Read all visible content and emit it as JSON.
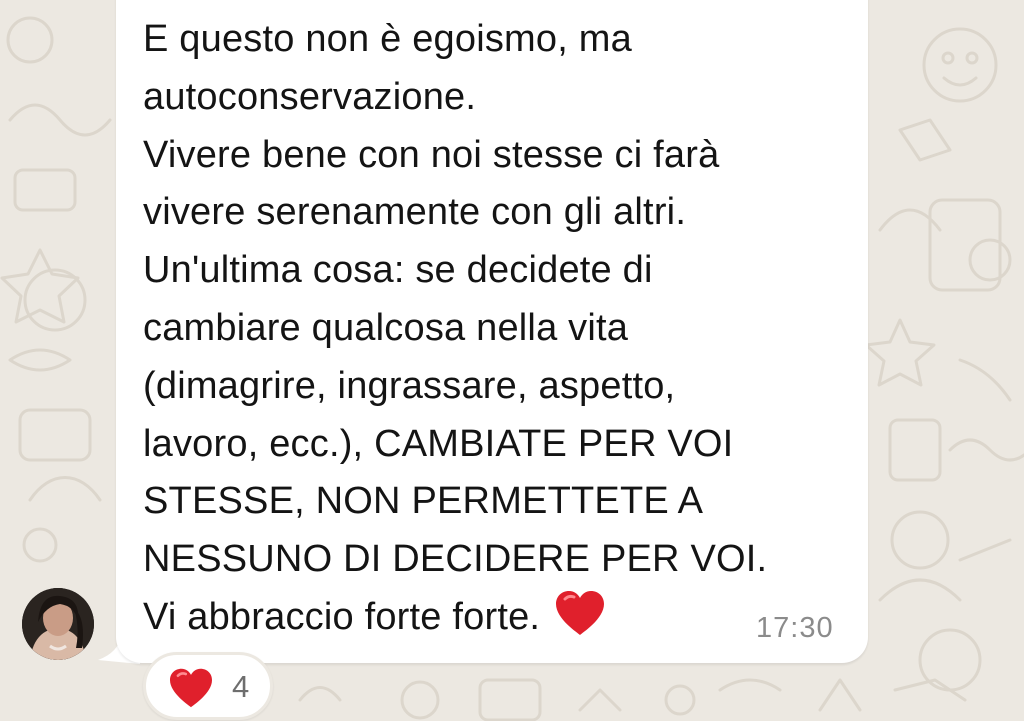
{
  "message": {
    "lines": [
      "E questo non è egoismo, ma",
      "autoconservazione.",
      "Vivere bene con noi stesse ci farà",
      "vivere serenamente con gli altri.",
      "Un'ultima cosa: se decidete di",
      "cambiare qualcosa nella vita",
      "(dimagrire, ingrassare, aspetto,",
      "lavoro, ecc.), CAMBIATE PER VOI",
      "STESSE, NON PERMETTETE A",
      "NESSUNO DI DECIDERE PER VOI.",
      "Vi abbraccio forte forte."
    ],
    "emoji_icon": "red-heart-icon",
    "timestamp": "17:30"
  },
  "reaction": {
    "emoji_icon": "red-heart-icon",
    "count": "4"
  },
  "sender": {
    "avatar_icon": "profile-photo"
  },
  "colors": {
    "background": "#ece8e1",
    "bubble": "#ffffff",
    "text": "#141414",
    "timestamp": "#8b8b8b",
    "heart": "#e0202c"
  }
}
